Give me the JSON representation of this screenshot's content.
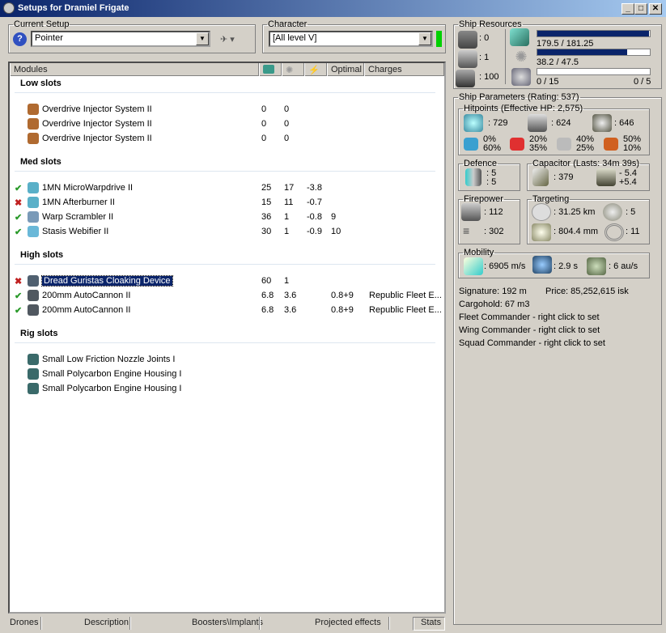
{
  "window": {
    "title": "Setups for Dramiel Frigate",
    "min": "_",
    "max": "□",
    "close": "✕"
  },
  "setup": {
    "label": "Current Setup",
    "value": "Pointer"
  },
  "character": {
    "label": "Character",
    "value": "[All level V]",
    "status_color": "#00d000"
  },
  "modules_header": {
    "modules": "Modules",
    "optimal": "Optimal",
    "charges": "Charges"
  },
  "sections": [
    {
      "title": "Low slots",
      "rows": [
        {
          "state": "",
          "name": "Overdrive Injector System II",
          "cpu": "0",
          "pg": "0",
          "cap": "",
          "optimal": "",
          "charges": "",
          "color": "#b06a30"
        },
        {
          "state": "",
          "name": "Overdrive Injector System II",
          "cpu": "0",
          "pg": "0",
          "cap": "",
          "optimal": "",
          "charges": "",
          "color": "#b06a30"
        },
        {
          "state": "",
          "name": "Overdrive Injector System II",
          "cpu": "0",
          "pg": "0",
          "cap": "",
          "optimal": "",
          "charges": "",
          "color": "#b06a30"
        }
      ]
    },
    {
      "title": "Med slots",
      "rows": [
        {
          "state": "on",
          "name": "1MN MicroWarpdrive II",
          "cpu": "25",
          "pg": "17",
          "cap": "-3.8",
          "optimal": "",
          "charges": "",
          "color": "#5ab0c8"
        },
        {
          "state": "off",
          "name": "1MN Afterburner II",
          "cpu": "15",
          "pg": "11",
          "cap": "-0.7",
          "optimal": "",
          "charges": "",
          "color": "#5ab0c8"
        },
        {
          "state": "on",
          "name": "Warp Scrambler II",
          "cpu": "36",
          "pg": "1",
          "cap": "-0.8",
          "optimal": "9",
          "charges": "",
          "color": "#7a9ab8"
        },
        {
          "state": "on",
          "name": "Stasis Webifier II",
          "cpu": "30",
          "pg": "1",
          "cap": "-0.9",
          "optimal": "10",
          "charges": "",
          "color": "#6ab8d8"
        }
      ]
    },
    {
      "title": "High slots",
      "rows": [
        {
          "state": "off",
          "name": "Dread Guristas Cloaking Device",
          "cpu": "60",
          "pg": "1",
          "cap": "",
          "optimal": "",
          "charges": "",
          "color": "#506070",
          "selected": true
        },
        {
          "state": "on",
          "name": "200mm AutoCannon II",
          "cpu": "6.8",
          "pg": "3.6",
          "cap": "",
          "optimal": "0.8+9",
          "charges": "Republic Fleet E...",
          "color": "#505860"
        },
        {
          "state": "on",
          "name": "200mm AutoCannon II",
          "cpu": "6.8",
          "pg": "3.6",
          "cap": "",
          "optimal": "0.8+9",
          "charges": "Republic Fleet E...",
          "color": "#505860"
        }
      ]
    },
    {
      "title": "Rig slots",
      "rows": [
        {
          "state": "",
          "name": "Small Low Friction Nozzle Joints I",
          "cpu": "",
          "pg": "",
          "cap": "",
          "optimal": "",
          "charges": "",
          "color": "#3a6a6a"
        },
        {
          "state": "",
          "name": "Small Polycarbon Engine Housing I",
          "cpu": "",
          "pg": "",
          "cap": "",
          "optimal": "",
          "charges": "",
          "color": "#3a6a6a"
        },
        {
          "state": "",
          "name": "Small Polycarbon Engine Housing I",
          "cpu": "",
          "pg": "",
          "cap": "",
          "optimal": "",
          "charges": "",
          "color": "#3a6a6a"
        }
      ]
    }
  ],
  "state_glyphs": {
    "on": "✔",
    "off": "✖"
  },
  "bottom_tabs": [
    "Drones",
    "Description",
    "Boosters\\Implants",
    "Projected effects",
    "Stats"
  ],
  "resources": {
    "title": "Ship Resources",
    "turrets": ": 0",
    "launchers": ": 1",
    "drone_bay": ": 100",
    "cpu": "179.5 / 181.25",
    "cpu_fraction": 0.99,
    "pg": "38.2 / 47.5",
    "pg_fraction": 0.8,
    "calibration": "0 / 15",
    "calibration_fraction": 0,
    "rigs": "0 / 5"
  },
  "params": {
    "title": "Ship Parameters (Rating: 537)",
    "hp_title": "Hitpoints (Effective HP: 2,575)",
    "shield": ": 729",
    "armor": ": 624",
    "hull": ": 646",
    "resists": [
      [
        "0%",
        "60%"
      ],
      [
        "20%",
        "35%"
      ],
      [
        "40%",
        "25%"
      ],
      [
        "50%",
        "10%"
      ]
    ],
    "defence_title": "Defence",
    "def1": ": 5",
    "def2": ": 5",
    "cap_title": "Capacitor (Lasts: 34m 39s)",
    "cap": ": 379",
    "cap_use": "- 5.4",
    "cap_regen": "+5.4",
    "fire_title": "Firepower",
    "volley": ": 112",
    "dps": ": 302",
    "targ_title": "Targeting",
    "range": ": 31.25 km",
    "targets": ": 5",
    "scanres": ": 804.4 mm",
    "sensor": ": 11",
    "mob_title": "Mobility",
    "speed": ": 6905 m/s",
    "align": ": 2.9 s",
    "warp": ": 6 au/s",
    "signature": "Signature: 192 m",
    "price": "Price: 85,252,615 isk",
    "cargo": "Cargohold: 67 m3",
    "fleet": "Fleet Commander - right click to set",
    "wing": "Wing Commander - right click to set",
    "squad": "Squad Commander - right click to set"
  }
}
